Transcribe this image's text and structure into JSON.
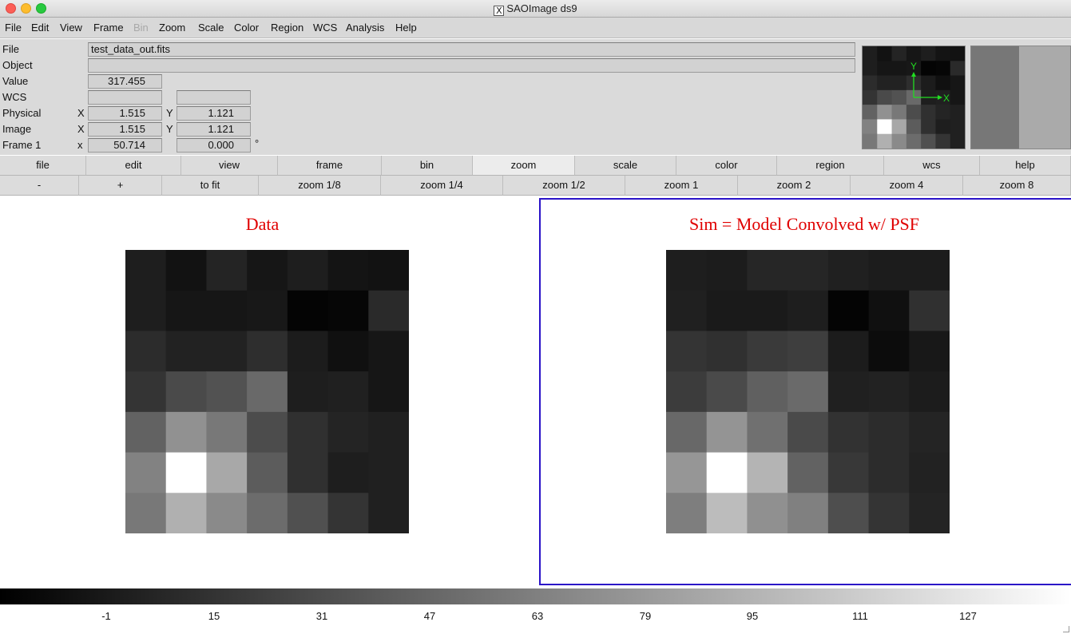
{
  "window": {
    "title": "SAOImage ds9"
  },
  "menu": [
    "File",
    "Edit",
    "View",
    "Frame",
    "Bin",
    "Zoom",
    "Scale",
    "Color",
    "Region",
    "WCS",
    "Analysis",
    "Help"
  ],
  "menu_disabled": [
    "Bin"
  ],
  "info": {
    "file_label": "File",
    "file_value": "test_data_out.fits",
    "object_label": "Object",
    "object_value": "",
    "value_label": "Value",
    "value_value": "317.455",
    "wcs_label": "WCS",
    "wcs_value1": "",
    "wcs_value2": "",
    "physical_label": "Physical",
    "physical_x_label": "X",
    "physical_x": "1.515",
    "physical_y_label": "Y",
    "physical_y": "1.121",
    "image_label": "Image",
    "image_x_label": "X",
    "image_x": "1.515",
    "image_y_label": "Y",
    "image_y": "1.121",
    "frame_label": "Frame 1",
    "frame_x_label": "x",
    "frame_zoom": "50.714",
    "frame_angle": "0.000",
    "frame_angle_unit": "°"
  },
  "panner": {
    "x_axis": "X",
    "y_axis": "Y",
    "axis_color": "#22dd22"
  },
  "buttonbar": [
    "file",
    "edit",
    "view",
    "frame",
    "bin",
    "zoom",
    "scale",
    "color",
    "region",
    "wcs",
    "help"
  ],
  "buttonbar_active": "zoom",
  "zoombar": [
    "-",
    "+",
    "to fit",
    "zoom 1/8",
    "zoom 1/4",
    "zoom 1/2",
    "zoom 1",
    "zoom 2",
    "zoom 4",
    "zoom 8"
  ],
  "frames": [
    {
      "title": "Data",
      "pixels": [
        [
          30,
          18,
          36,
          22,
          30,
          20,
          18
        ],
        [
          30,
          22,
          22,
          24,
          4,
          6,
          42
        ],
        [
          44,
          34,
          34,
          46,
          28,
          16,
          22
        ],
        [
          52,
          74,
          82,
          105,
          30,
          32,
          22
        ],
        [
          98,
          145,
          120,
          76,
          48,
          36,
          32
        ],
        [
          130,
          255,
          168,
          92,
          48,
          30,
          32
        ],
        [
          120,
          176,
          138,
          108,
          80,
          52,
          32
        ]
      ]
    },
    {
      "title": "Sim = Model Convolved w/ PSF",
      "pixels": [
        [
          30,
          28,
          38,
          38,
          32,
          28,
          28
        ],
        [
          32,
          26,
          26,
          30,
          4,
          16,
          48
        ],
        [
          52,
          48,
          58,
          62,
          28,
          12,
          24
        ],
        [
          60,
          74,
          96,
          106,
          32,
          34,
          28
        ],
        [
          104,
          148,
          112,
          74,
          50,
          44,
          36
        ],
        [
          150,
          255,
          180,
          98,
          56,
          44,
          34
        ],
        [
          126,
          188,
          144,
          128,
          78,
          52,
          36
        ]
      ]
    }
  ],
  "colorbar": {
    "ticks": [
      "-1",
      "15",
      "31",
      "47",
      "63",
      "79",
      "95",
      "111",
      "127"
    ],
    "low": "#000000",
    "high": "#ffffff"
  },
  "frame_highlight_color": "#2a13c8",
  "title_color": "#e00000"
}
